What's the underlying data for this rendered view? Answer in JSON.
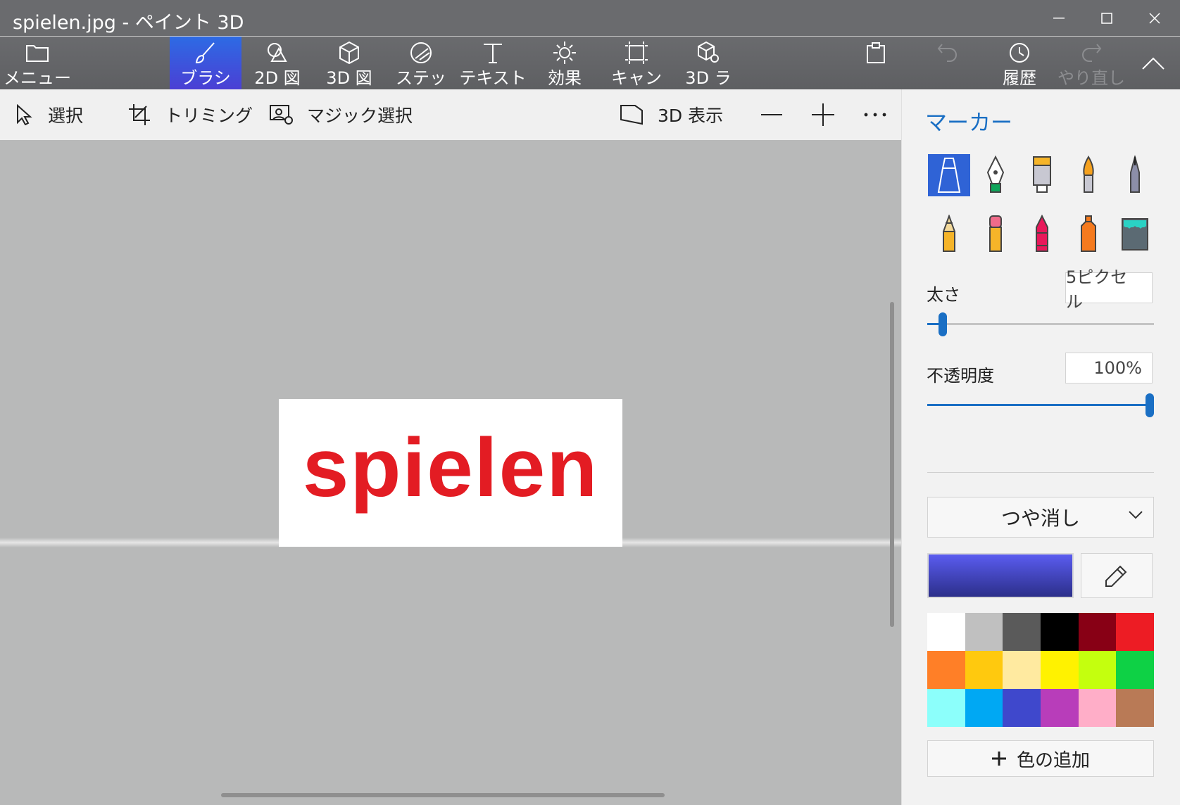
{
  "window": {
    "title": "spielen.jpg - ペイント 3D"
  },
  "ribbon": {
    "menu_label": "メニュー",
    "tabs": [
      {
        "label": "ブラシ"
      },
      {
        "label": "2D 図"
      },
      {
        "label": "3D 図"
      },
      {
        "label": "ステッ"
      },
      {
        "label": "テキスト"
      },
      {
        "label": "効果"
      },
      {
        "label": "キャン"
      },
      {
        "label": "3D ラ"
      }
    ],
    "history_label": "履歴",
    "redo_label": "やり直し"
  },
  "command_bar": {
    "select_label": "選択",
    "crop_label": "トリミング",
    "magic_select_label": "マジック選択",
    "view3d_label": "3D 表示"
  },
  "canvas": {
    "text": "spielen",
    "text_color": "#e31c23"
  },
  "panel": {
    "title": "マーカー",
    "thickness_label": "太さ",
    "thickness_value": "5ピクセル",
    "thickness_level": 0.05,
    "opacity_label": "不透明度",
    "opacity_value": "100%",
    "opacity_level": 1.0,
    "finish_value": "つや消し",
    "current_color": "#4a4cd6",
    "palette": [
      "#ffffff",
      "#c0c0c0",
      "#5a5a5a",
      "#000000",
      "#880015",
      "#ed1c24",
      "#ff7f27",
      "#ffc90e",
      "#ffeaa0",
      "#fff200",
      "#c4ff0e",
      "#0ed145",
      "#8cfffb",
      "#00a8f3",
      "#3f48cc",
      "#b83dba",
      "#ffaec8",
      "#b97a56"
    ],
    "add_color_label": "色の追加"
  },
  "colors": {
    "accent": "#1a6fc4",
    "active_tab": "#2d6be4"
  }
}
